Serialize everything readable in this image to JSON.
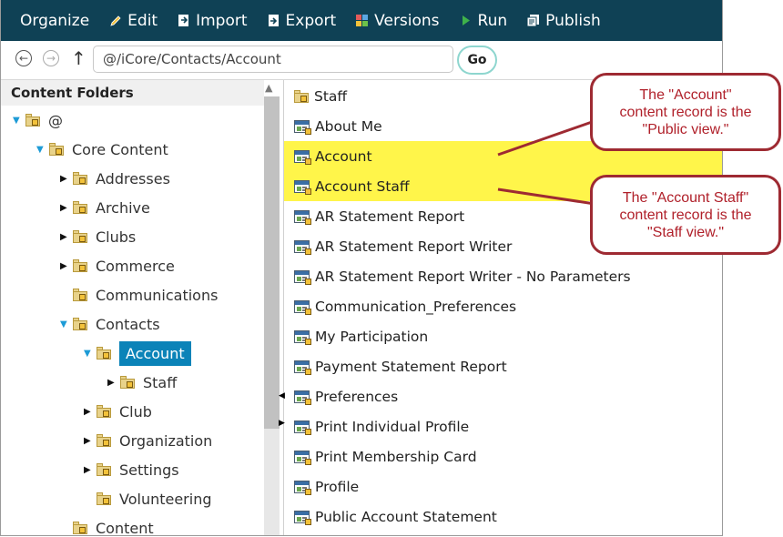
{
  "toolbar": {
    "items": [
      {
        "label": "Organize",
        "icon": "none"
      },
      {
        "label": "Edit",
        "icon": "pencil-icon"
      },
      {
        "label": "Import",
        "icon": "import-icon"
      },
      {
        "label": "Export",
        "icon": "export-icon"
      },
      {
        "label": "Versions",
        "icon": "versions-icon"
      },
      {
        "label": "Run",
        "icon": "run-icon"
      },
      {
        "label": "Publish",
        "icon": "publish-icon"
      }
    ]
  },
  "address": {
    "path": "@/iCore/Contacts/Account",
    "go_label": "Go"
  },
  "left_panel": {
    "header": "Content Folders",
    "tree": [
      {
        "label": "@",
        "indent": 0,
        "toggle": "open"
      },
      {
        "label": "Core Content",
        "indent": 1,
        "toggle": "open"
      },
      {
        "label": "Addresses",
        "indent": 2,
        "toggle": "closed"
      },
      {
        "label": "Archive",
        "indent": 2,
        "toggle": "closed"
      },
      {
        "label": "Clubs",
        "indent": 2,
        "toggle": "closed"
      },
      {
        "label": "Commerce",
        "indent": 2,
        "toggle": "closed"
      },
      {
        "label": "Communications",
        "indent": 2,
        "toggle": "none"
      },
      {
        "label": "Contacts",
        "indent": 2,
        "toggle": "open"
      },
      {
        "label": "Account",
        "indent": 3,
        "toggle": "open",
        "selected": true
      },
      {
        "label": "Staff",
        "indent": 4,
        "toggle": "closed"
      },
      {
        "label": "Club",
        "indent": 3,
        "toggle": "closed"
      },
      {
        "label": "Organization",
        "indent": 3,
        "toggle": "closed"
      },
      {
        "label": "Settings",
        "indent": 3,
        "toggle": "closed"
      },
      {
        "label": "Volunteering",
        "indent": 3,
        "toggle": "none"
      },
      {
        "label": "Content",
        "indent": 2,
        "toggle": "none"
      }
    ]
  },
  "right_panel": {
    "items": [
      {
        "label": "Staff",
        "type": "folder"
      },
      {
        "label": "About Me",
        "type": "record"
      },
      {
        "label": "Account",
        "type": "record",
        "highlight": true
      },
      {
        "label": "Account Staff",
        "type": "record",
        "highlight": true
      },
      {
        "label": "AR Statement Report",
        "type": "record"
      },
      {
        "label": "AR Statement Report Writer",
        "type": "record"
      },
      {
        "label": "AR Statement Report Writer - No Parameters",
        "type": "record"
      },
      {
        "label": "Communication_Preferences",
        "type": "record"
      },
      {
        "label": "My Participation",
        "type": "record"
      },
      {
        "label": "Payment Statement Report",
        "type": "record"
      },
      {
        "label": "Preferences",
        "type": "record"
      },
      {
        "label": "Print Individual Profile",
        "type": "record"
      },
      {
        "label": "Print Membership Card",
        "type": "record"
      },
      {
        "label": "Profile",
        "type": "record"
      },
      {
        "label": "Public Account Statement",
        "type": "record"
      }
    ]
  },
  "callouts": [
    {
      "text": "The \"Account\"\ncontent record is the\n\"Public view.\""
    },
    {
      "text": "The \"Account Staff\"\ncontent record is the\n\"Staff view.\""
    }
  ],
  "colors": {
    "toolbar_bg": "#0f4155",
    "selected_bg": "#0b83b8",
    "highlight": "#fff54a",
    "callout_border": "#9e2a32",
    "callout_text": "#b0202a"
  }
}
